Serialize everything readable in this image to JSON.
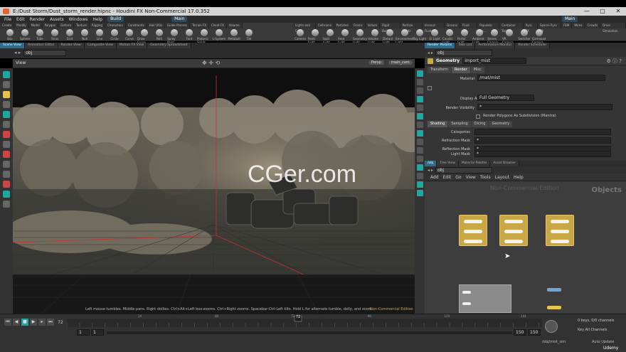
{
  "window": {
    "title": "E:/Dust Storm/Dust_storm_render.hipnc - Houdini FX Non-Commercial 17.0.352",
    "controls": [
      "—",
      "□",
      "✕"
    ]
  },
  "menu": {
    "items": [
      "File",
      "Edit",
      "Render",
      "Assets",
      "Windows",
      "Help"
    ],
    "build": "Build",
    "desktop": "Main",
    "desktop_right": "Main"
  },
  "shelf": {
    "tabs_left": [
      "Create",
      "Modify",
      "Model",
      "Polygon",
      "Deform",
      "Texture",
      "Rigging",
      "Characters",
      "Constraints",
      "Hair Utils",
      "Guide Process",
      "Terrain FX",
      "Cloud FX",
      "Volume"
    ],
    "tools_left": [
      "Box",
      "Sphere",
      "Tube",
      "Torus",
      "Grid",
      "Null",
      "Line",
      "Circle",
      "Curve",
      "Draw Curve",
      "Path",
      "Spray Paint",
      "Font",
      "Platonic Solids",
      "L-System",
      "Metaball",
      "File"
    ],
    "tabs_right": [
      "Lights and C...",
      "Collisions",
      "Particles",
      "Grains",
      "Vellum",
      "Rigid Bodies",
      "Particle Fluids",
      "Viscous Fluids",
      "Oceans",
      "Fluid Co...",
      "Populate Co...",
      "Container Tools",
      "Pyro FX",
      "Sparse Pyro FX",
      "FEM",
      "Wires",
      "Crowds",
      "Drive Simulation"
    ],
    "tools_right": [
      "Camera",
      "Point Light",
      "Spot Light",
      "Area Light",
      "Geometry Light",
      "Volume Light",
      "Distant Light",
      "Environment Light",
      "Sky Light",
      "GI Light",
      "Caustic Light",
      "Portal Light",
      "Ambient Light",
      "Stereo Camera",
      "VR Camera",
      "Switcher",
      "Gamepad Camera"
    ]
  },
  "left_tabs": [
    "Scene View",
    "Animation Editor",
    "Render View",
    "Composite View",
    "Motion FX View",
    "Geometry Spreadsheet"
  ],
  "viewport": {
    "path": "obj",
    "label": "View",
    "persp": "Persp",
    "camera": "main_cam",
    "watermark": "CGer.com",
    "hint": "Left mouse tumbles. Middle pans. Right dollies. Ctrl+Alt+Left box-zooms. Ctrl+Right zooms. Spacebar-Ctrl-Left tilts. Hold L for alternate tumble, dolly, and zoom.",
    "non_commercial": "Non-Commercial Edition"
  },
  "param_tabs": [
    "Render Params",
    "Take List",
    "Performance Monitor",
    "Render Scheduler"
  ],
  "params": {
    "path": "obj",
    "node_type": "Geometry",
    "node_name": "import_mist",
    "tabs": [
      "Transform",
      "Render",
      "Misc"
    ],
    "material_label": "Material",
    "material_value": "/mat/mist",
    "display_as_label": "Display As",
    "display_as_value": "Full Geometry",
    "render_visibility_label": "Render Visibility",
    "render_visibility_value": "*",
    "subdivision_label": "Render Polygons As Subdivision (Mantra)",
    "sub_tabs": [
      "Shading",
      "Sampling",
      "Dicing",
      "Geometry"
    ],
    "categories_label": "Categories",
    "refraction_mask_label": "Refraction Mask",
    "refraction_mask_value": "*",
    "reflection_mask_label": "Reflection Mask",
    "reflection_mask_value": "*",
    "light_mask_label": "Light Mask",
    "light_mask_value": "*"
  },
  "network": {
    "tabs": [
      "/obj",
      "Tree View",
      "Material Palette",
      "Asset Browser"
    ],
    "path": "obj",
    "menu": [
      "Add",
      "Edit",
      "Go",
      "View",
      "Tools",
      "Layout",
      "Help"
    ],
    "watermark": "Non-Commercial Edition",
    "context": "Objects"
  },
  "timeline": {
    "current_frame": "72",
    "start": "1",
    "start2": "1",
    "end": "150",
    "end2": "150",
    "ruler_marks": [
      "24",
      "48",
      "72",
      "96",
      "120",
      "144"
    ],
    "keys_info": "0 keys, 0/0 channels",
    "key_channels": "Key All Channels",
    "status_path": "/obj/mist_sim",
    "auto_update": "Auto Update",
    "brand": "Udemy"
  },
  "colors": {
    "accent": "#1fa7a0",
    "tab_active": "#2e6b8a",
    "node": "#c9a646"
  }
}
